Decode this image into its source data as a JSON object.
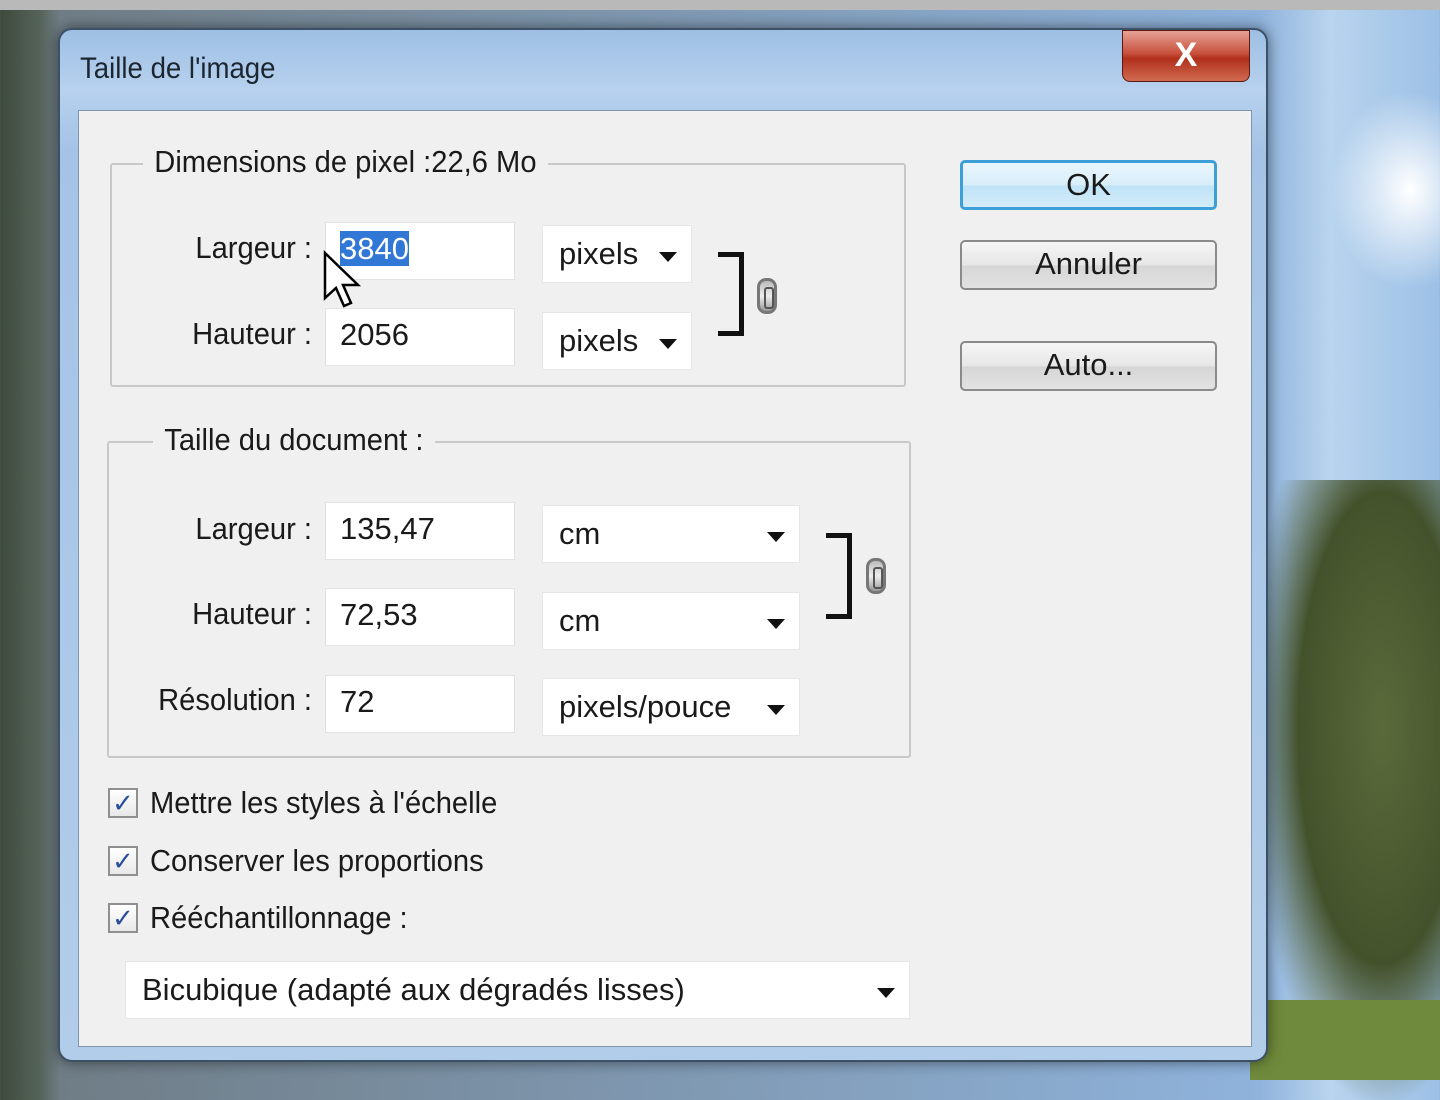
{
  "dialog": {
    "title": "Taille de l'image",
    "close_label": "X"
  },
  "pixel_dims": {
    "legend": "Dimensions de pixel :22,6 Mo",
    "width_label": "Largeur :",
    "width_value": "3840",
    "width_unit": "pixels",
    "height_label": "Hauteur :",
    "height_value": "2056",
    "height_unit": "pixels"
  },
  "doc_size": {
    "legend": "Taille du document :",
    "width_label": "Largeur :",
    "width_value": "135,47",
    "width_unit": "cm",
    "height_label": "Hauteur :",
    "height_value": "72,53",
    "height_unit": "cm",
    "res_label": "Résolution :",
    "res_value": "72",
    "res_unit": "pixels/pouce"
  },
  "options": {
    "scale_styles": "Mettre les styles à l'échelle",
    "constrain": "Conserver les proportions",
    "resample": "Rééchantillonnage :",
    "check": "✓",
    "resample_method": "Bicubique (adapté aux dégradés lisses)"
  },
  "buttons": {
    "ok": "OK",
    "cancel": "Annuler",
    "auto": "Auto..."
  }
}
